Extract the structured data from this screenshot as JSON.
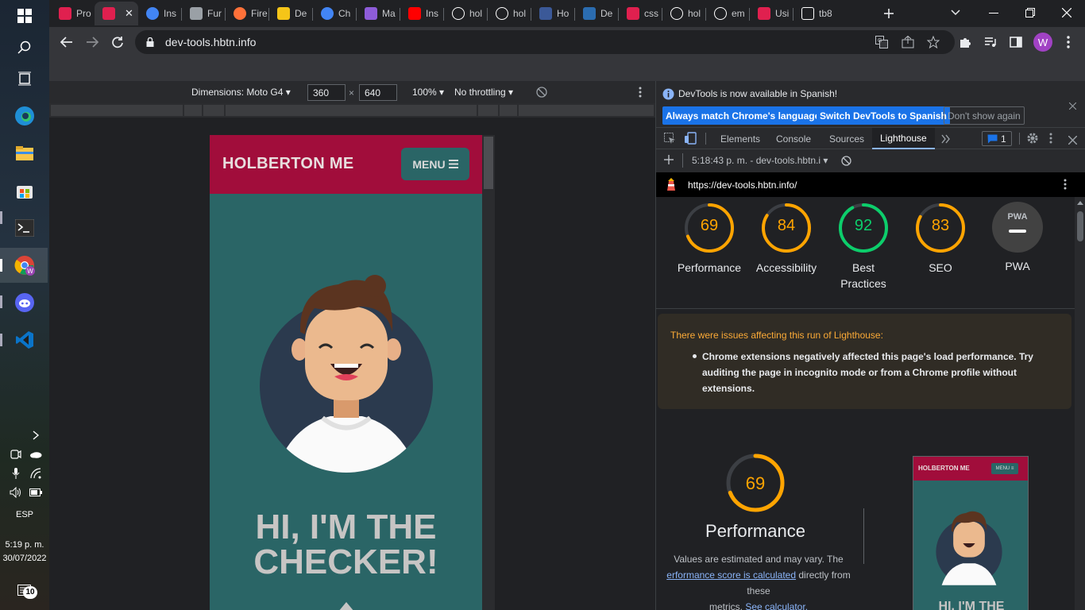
{
  "taskbar": {
    "language": "ESP",
    "time": "5:19 p. m.",
    "date": "30/07/2022",
    "notification_count": "10"
  },
  "tabs": [
    {
      "title": "Pro",
      "icon": "holberton-icon",
      "color": "#e0204f"
    },
    {
      "title": "",
      "icon": "holberton-icon",
      "color": "#e0204f",
      "active": true
    },
    {
      "title": "Ins",
      "icon": "chrome-icon",
      "color": "#4285f4"
    },
    {
      "title": "Fur",
      "icon": "book-icon",
      "color": "#9aa0a6"
    },
    {
      "title": "Fire",
      "icon": "firefox-icon",
      "color": "#ff7139"
    },
    {
      "title": "De",
      "icon": "u-icon",
      "color": "#f5c518"
    },
    {
      "title": "Ch",
      "icon": "chrome-icon",
      "color": "#4285f4"
    },
    {
      "title": "Ma",
      "icon": "rocket-icon",
      "color": "#8e5cd9"
    },
    {
      "title": "Ins",
      "icon": "youtube-icon",
      "color": "#ff0000"
    },
    {
      "title": "hol",
      "icon": "github-icon",
      "color": "#ffffff"
    },
    {
      "title": "hol",
      "icon": "github-icon",
      "color": "#ffffff"
    },
    {
      "title": "Ho",
      "icon": "c-icon",
      "color": "#3b5998"
    },
    {
      "title": "De",
      "icon": "cube-icon",
      "color": "#2b6cb0"
    },
    {
      "title": "css",
      "icon": "holberton-icon",
      "color": "#e0204f"
    },
    {
      "title": "hol",
      "icon": "github-icon",
      "color": "#ffffff"
    },
    {
      "title": "em",
      "icon": "google-icon",
      "color": "#ffffff"
    },
    {
      "title": "Usi",
      "icon": "holberton-icon",
      "color": "#e0204f"
    },
    {
      "title": "tb8",
      "icon": "info-icon",
      "color": "#ffffff"
    }
  ],
  "address": {
    "url": "dev-tools.hbtn.info",
    "profile_initial": "W"
  },
  "device_toolbar": {
    "dimensions_label": "Dimensions: Moto G4",
    "width": "360",
    "height": "640",
    "zoom": "100%",
    "throttling": "No throttling",
    "times": "×"
  },
  "site": {
    "logo": "HOLBERTON ME",
    "menu_label": "MENU",
    "hero_line1": "HI, I'M THE",
    "hero_line2": "CHECKER!"
  },
  "devtools": {
    "info_message": "DevTools is now available in Spanish!",
    "btn_match_language": "Always match Chrome's language",
    "btn_switch_spanish": "Switch DevTools to Spanish",
    "btn_dont_show": "Don't show again",
    "tabs": [
      "Elements",
      "Console",
      "Sources",
      "Lighthouse"
    ],
    "issues_count": "1",
    "report_time": "5:18:43 p. m. - dev-tools.hbtn.i",
    "report_url": "https://dev-tools.hbtn.info/"
  },
  "lighthouse": {
    "scores": [
      {
        "label": "Performance",
        "value": "69",
        "score": 0.69,
        "color": "#ffa400"
      },
      {
        "label": "Accessibility",
        "value": "84",
        "score": 0.84,
        "color": "#ffa400"
      },
      {
        "label": "Best Practices",
        "value": "92",
        "score": 0.92,
        "color": "#0cce6b"
      },
      {
        "label": "SEO",
        "value": "83",
        "score": 0.83,
        "color": "#ffa400"
      }
    ],
    "pwa_label": "PWA",
    "pwa_badge": "PWA",
    "warning_title": "There were issues affecting this run of Lighthouse:",
    "warning_item": "Chrome extensions negatively affected this page's load performance. Try auditing the page in incognito mode or from a Chrome profile without extensions.",
    "perf_score": "69",
    "perf_title": "Performance",
    "perf_note_1": "Values are estimated and may vary. The",
    "perf_note_link": "erformance score is calculated",
    "perf_note_2": "directly from these",
    "perf_note_3": "metrics.",
    "perf_note_link2": "See calculator.",
    "shot_logo": "HOLBERTON ME",
    "shot_menu": "MENU ≡",
    "shot_hero": "HI, I'M THE"
  }
}
